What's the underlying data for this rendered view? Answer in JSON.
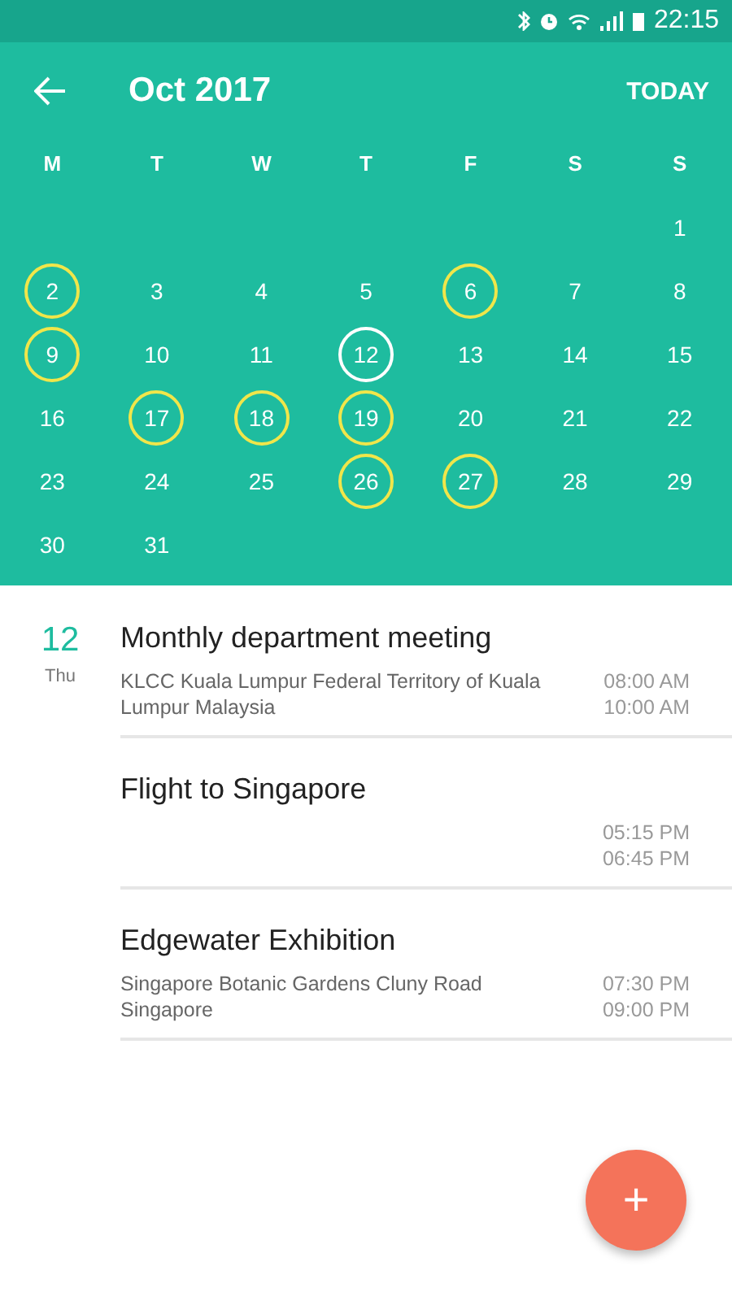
{
  "status_bar": {
    "time": "22:15"
  },
  "header": {
    "title": "Oct 2017",
    "today_label": "TODAY"
  },
  "weekdays": [
    "M",
    "T",
    "W",
    "T",
    "F",
    "S",
    "S"
  ],
  "weeks": [
    {
      "days": [
        {
          "day": "1",
          "marked": false,
          "selected": false
        }
      ]
    },
    {
      "days": [
        {
          "day": "2",
          "marked": true,
          "selected": false
        },
        {
          "day": "3",
          "marked": false,
          "selected": false
        },
        {
          "day": "4",
          "marked": false,
          "selected": false
        },
        {
          "day": "5",
          "marked": false,
          "selected": false
        },
        {
          "day": "6",
          "marked": true,
          "selected": false
        },
        {
          "day": "7",
          "marked": false,
          "selected": false
        },
        {
          "day": "8",
          "marked": false,
          "selected": false
        }
      ]
    },
    {
      "days": [
        {
          "day": "9",
          "marked": true,
          "selected": false
        },
        {
          "day": "10",
          "marked": false,
          "selected": false
        },
        {
          "day": "11",
          "marked": false,
          "selected": false
        },
        {
          "day": "12",
          "marked": false,
          "selected": true
        },
        {
          "day": "13",
          "marked": false,
          "selected": false
        },
        {
          "day": "14",
          "marked": false,
          "selected": false
        },
        {
          "day": "15",
          "marked": false,
          "selected": false
        }
      ]
    },
    {
      "days": [
        {
          "day": "16",
          "marked": false,
          "selected": false
        },
        {
          "day": "17",
          "marked": true,
          "selected": false
        },
        {
          "day": "18",
          "marked": true,
          "selected": false
        },
        {
          "day": "19",
          "marked": true,
          "selected": false
        },
        {
          "day": "20",
          "marked": false,
          "selected": false
        },
        {
          "day": "21",
          "marked": false,
          "selected": false
        },
        {
          "day": "22",
          "marked": false,
          "selected": false
        }
      ]
    },
    {
      "days": [
        {
          "day": "23",
          "marked": false,
          "selected": false
        },
        {
          "day": "24",
          "marked": false,
          "selected": false
        },
        {
          "day": "25",
          "marked": false,
          "selected": false
        },
        {
          "day": "26",
          "marked": true,
          "selected": false
        },
        {
          "day": "27",
          "marked": true,
          "selected": false
        },
        {
          "day": "28",
          "marked": false,
          "selected": false
        },
        {
          "day": "29",
          "marked": false,
          "selected": false
        }
      ]
    },
    {
      "days": [
        {
          "day": "30",
          "marked": false,
          "selected": false
        },
        {
          "day": "31",
          "marked": false,
          "selected": false
        }
      ]
    }
  ],
  "agenda": {
    "date": "12",
    "weekday": "Thu",
    "events": [
      {
        "title": "Monthly department meeting",
        "location": "KLCC Kuala Lumpur Federal Territory of Kuala Lumpur Malaysia",
        "start": "08:00 AM",
        "end": "10:00 AM"
      },
      {
        "title": "Flight to Singapore",
        "start": "05:15 PM",
        "end": "06:45 PM"
      },
      {
        "title": "Edgewater Exhibition",
        "location": "Singapore Botanic Gardens Cluny Road Singapore",
        "start": "07:30 PM",
        "end": "09:00 PM"
      }
    ]
  },
  "fab": {
    "label": "+"
  }
}
